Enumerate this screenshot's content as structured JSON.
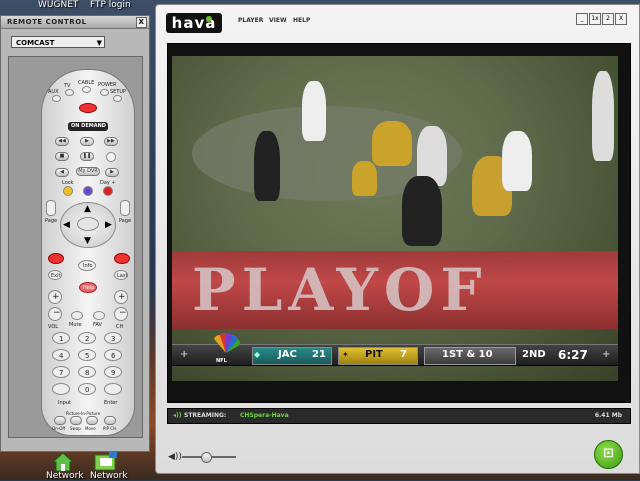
{
  "desktop": {
    "icons": [
      {
        "label": "WUGNET",
        "icon": "network-icon"
      },
      {
        "label": "FTP login",
        "icon": "ftp-icon"
      },
      {
        "label": "Network",
        "icon": "home-network-icon"
      },
      {
        "label": "Network",
        "icon": "network-folder-icon"
      }
    ]
  },
  "remote": {
    "title": "REMOTE CONTROL",
    "close_label": "X",
    "provider": "COMCAST",
    "labels": {
      "aux": "AUX",
      "tv": "TV",
      "cable": "CABLE",
      "power": "POWER",
      "setup": "SETUP",
      "on_demand": "ON DEMAND",
      "my_dvr": "My DVR",
      "lock": "Lock",
      "day_minus": "Day -",
      "day_plus": "Day +",
      "page": "Page",
      "page2": "Page",
      "exit": "Exit",
      "info": "Info",
      "last": "Last",
      "help": "Help",
      "vol": "VOL",
      "mute": "Mute",
      "fav": "FAV",
      "ch": "CH",
      "input": "Input",
      "enter": "Enter",
      "on_off": "On-Off",
      "swap": "Swap",
      "move": "Move",
      "pip_ch": "PIP CH",
      "pip": "Picture-In-Picture",
      "keys": [
        "1",
        "2",
        "3",
        "4",
        "5",
        "6",
        "7",
        "8",
        "9",
        "",
        "0",
        ""
      ]
    }
  },
  "hava": {
    "logo": "hava",
    "menu": [
      "PLAYER",
      "VIEW",
      "HELP"
    ],
    "window_buttons": [
      "_",
      "1x",
      "2",
      "X"
    ],
    "status": {
      "label": "STREAMING:",
      "source": "CHSpera-Hava",
      "rate": "6.41 Mb"
    },
    "colors": {
      "accent": "#6cbf2a",
      "status_bg": "#2a2a2a",
      "stream_text": "#6cd83a"
    }
  },
  "video": {
    "endzone_text": "PLAYOF",
    "scorebar": {
      "league": "NFL",
      "away_team": "JAC",
      "away_score": "21",
      "home_team": "PIT",
      "home_score": "7",
      "down": "1ST & 10",
      "quarter": "2ND",
      "clock": "6:27"
    }
  },
  "volume": {
    "level": 0.45
  }
}
